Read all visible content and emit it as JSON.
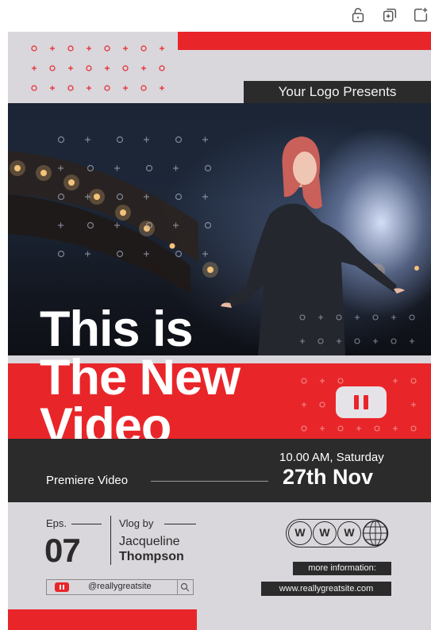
{
  "toolbar": {
    "lock_icon": "lock-icon",
    "duplicate_icon": "duplicate-icon",
    "add_page_icon": "add-page-icon"
  },
  "poster": {
    "logo_text": "Your Logo Presents",
    "headline": [
      "This is",
      "The New",
      "Video"
    ],
    "play_icon": "pause-icon",
    "premiere_label": "Premiere Video",
    "time_text": "10.00 AM, Saturday",
    "date_text": "27th Nov",
    "eps_label": "Eps.",
    "eps_number": "07",
    "vlog_label": "Vlog by",
    "host_first": "Jacqueline",
    "host_last": "Thompson",
    "social_handle": "@reallygreatsite",
    "www_letters": [
      "W",
      "W",
      "W"
    ],
    "more_info": "more information:",
    "website": "www.reallygreatsite.com"
  },
  "colors": {
    "accent_red": "#e8262a",
    "dark": "#2b2b2b",
    "background": "#d9d6dc"
  }
}
